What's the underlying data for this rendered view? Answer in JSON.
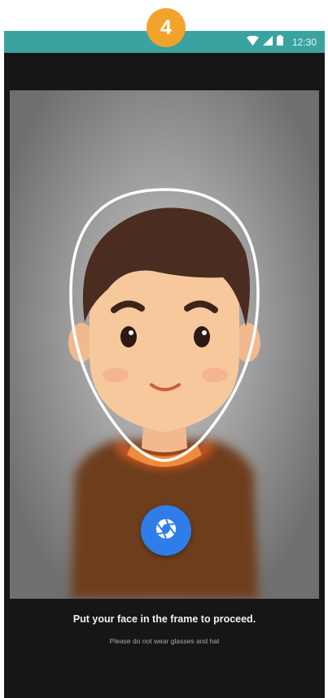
{
  "step": {
    "number": "4",
    "color": "#f2a32c"
  },
  "status_bar": {
    "time": "12:30",
    "background": "#3aa39f",
    "icons": [
      "wifi-icon",
      "signal-icon",
      "battery-icon"
    ]
  },
  "camera": {
    "frame_shape": "face-oval",
    "shutter_icon": "aperture-icon",
    "shutter_color": "#2f7de8"
  },
  "instruction": {
    "title": "Put your face in the frame to proceed.",
    "hint": "Please do not wear glasses and hat"
  }
}
